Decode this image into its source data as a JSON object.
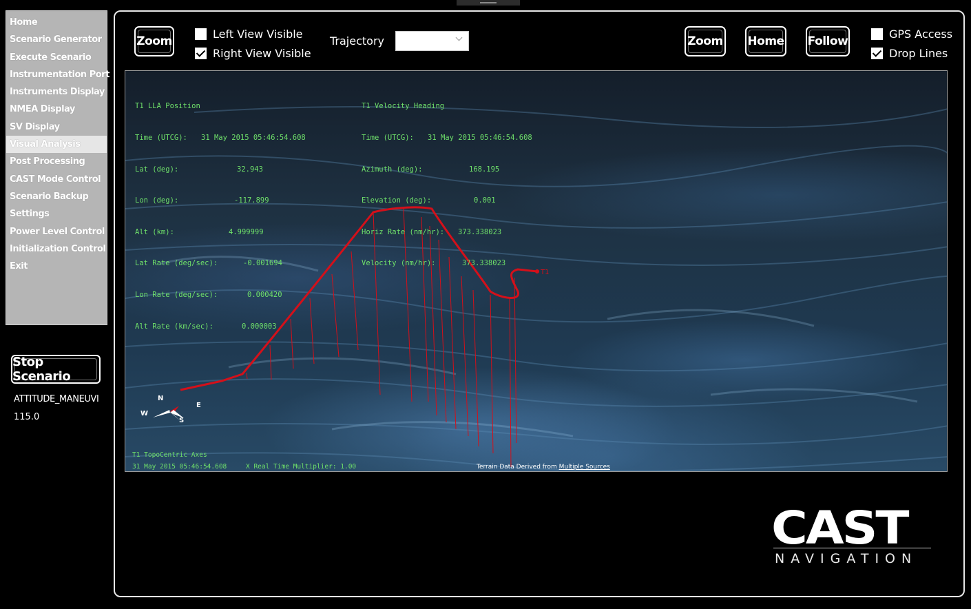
{
  "sidebar": {
    "items": [
      {
        "label": "Home"
      },
      {
        "label": "Scenario Generator"
      },
      {
        "label": "Execute Scenario"
      },
      {
        "label": "Instrumentation Port"
      },
      {
        "label": "Instruments Display"
      },
      {
        "label": "NMEA Display"
      },
      {
        "label": "SV Display"
      },
      {
        "label": "Visual Analysis",
        "selected": true
      },
      {
        "label": "Post Processing"
      },
      {
        "label": "CAST Mode Control"
      },
      {
        "label": "Scenario Backup"
      },
      {
        "label": "Settings"
      },
      {
        "label": "Power Level Control"
      },
      {
        "label": "Initialization Control"
      },
      {
        "label": "Exit"
      }
    ],
    "stop_button": "Stop Scenario",
    "scenario_name": "ATTITUDE_MANEUVI",
    "scenario_value": "115.0"
  },
  "toolbar": {
    "left_zoom": "Zoom",
    "left_view_visible": {
      "label": "Left View Visible",
      "checked": false
    },
    "right_view_visible": {
      "label": "Right View Visible",
      "checked": true
    },
    "trajectory_label": "Trajectory",
    "trajectory_value": "",
    "right_zoom": "Zoom",
    "home": "Home",
    "follow": "Follow",
    "gps_access": {
      "label": "GPS Access",
      "checked": false
    },
    "drop_lines": {
      "label": "Drop Lines",
      "checked": true
    }
  },
  "view": {
    "lla": {
      "title": "T1 LLA Position",
      "rows": [
        {
          "label": "Time (UTCG):",
          "value": "31 May 2015 05:46:54.608"
        },
        {
          "label": "Lat (deg):",
          "value": "32.943"
        },
        {
          "label": "Lon (deg):",
          "value": "-117.899"
        },
        {
          "label": "Alt (km):",
          "value": "4.999999"
        },
        {
          "label": "Lat Rate (deg/sec):",
          "value": "-0.001694"
        },
        {
          "label": "Lon Rate (deg/sec):",
          "value": "0.000420"
        },
        {
          "label": "Alt Rate (km/sec):",
          "value": "0.000003"
        }
      ]
    },
    "velocity": {
      "title": "T1 Velocity Heading",
      "rows": [
        {
          "label": "Time (UTCG):",
          "value": "31 May 2015 05:46:54.608"
        },
        {
          "label": "Azimuth (deg):",
          "value": "168.195"
        },
        {
          "label": "Elevation (deg):",
          "value": "0.001"
        },
        {
          "label": "Horiz Rate (nm/hr):",
          "value": "373.338023"
        },
        {
          "label": "Velocity (nm/hr):",
          "value": "373.338023"
        }
      ]
    },
    "axes_label": "T1 TopoCentric Axes",
    "footer_time": "31 May 2015 05:46:54.608",
    "footer_multiplier": "X Real Time Multiplier: 1.00",
    "terrain_prefix": "Terrain Data Derived from ",
    "terrain_link": "Multiple Sources",
    "vehicle_label": "T1",
    "compass": {
      "n": "N",
      "e": "E",
      "s": "S",
      "w": "W"
    },
    "colors": {
      "trajectory": "#d4101a",
      "hud": "#6fe06a"
    }
  },
  "logo": {
    "main": "CAST",
    "sub": "NAVIGATION"
  }
}
